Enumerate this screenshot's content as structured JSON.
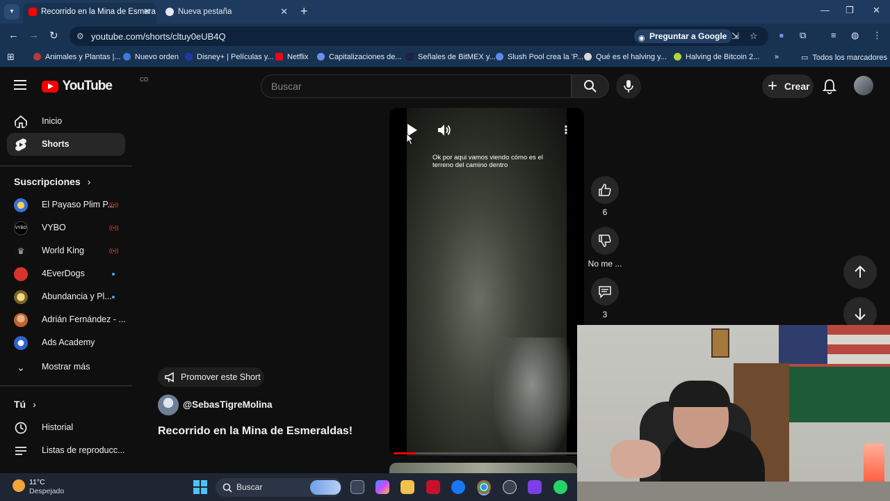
{
  "browser": {
    "tabs": [
      {
        "label": "Recorrido en la Mina de Esmera",
        "active": true
      },
      {
        "label": "Nueva pestaña",
        "active": false
      }
    ],
    "url": "youtube.com/shorts/cltuy0eUB4Q",
    "ask_google": "Preguntar a Google",
    "bookmarks": [
      "Animales y Plantas |...",
      "Nuevo orden",
      "Disney+ | Películas y...",
      "Netflix",
      "Capitalizaciones de...",
      "Señales de BitMEX y...",
      "Slush Pool crea la 'P...",
      "Qué es el halving y...",
      "Halving de Bitcoin 2..."
    ],
    "all_bookmarks": "Todos los marcadores"
  },
  "youtube": {
    "logo_word": "YouTube",
    "country_code": "CO",
    "search_placeholder": "Buscar",
    "create_label": "Crear"
  },
  "sidebar": {
    "main": [
      {
        "label": "Inicio"
      },
      {
        "label": "Shorts",
        "active": true
      }
    ],
    "subscriptions_title": "Suscripciones",
    "subscriptions": [
      {
        "label": "El Payaso Plim P...",
        "indicator": "live"
      },
      {
        "label": "VYBO",
        "indicator": "live"
      },
      {
        "label": "World King",
        "indicator": "live"
      },
      {
        "label": "4EverDogs",
        "indicator": "new"
      },
      {
        "label": "Abundancia y Pl...",
        "indicator": "new"
      },
      {
        "label": "Adrián Fernández - ...",
        "indicator": ""
      },
      {
        "label": "Ads Academy",
        "indicator": ""
      }
    ],
    "show_more": "Mostrar más",
    "you_title": "Tú",
    "you_items": [
      {
        "label": "Historial"
      },
      {
        "label": "Listas de reproducc..."
      }
    ]
  },
  "short": {
    "promote_label": "Promover este Short",
    "channel": "@SebasTigreMolina",
    "title": "Recorrido en la Mina de Esmeraldas!",
    "caption": "Ok por aqui vamos viendo cómo es el terreno del camino dentro",
    "progress_fraction": 0.12,
    "likes": "6",
    "dislike_label": "No me ...",
    "comments": "3"
  },
  "taskbar": {
    "temperature": "11°C",
    "condition": "Despejado",
    "search_label": "Buscar"
  }
}
